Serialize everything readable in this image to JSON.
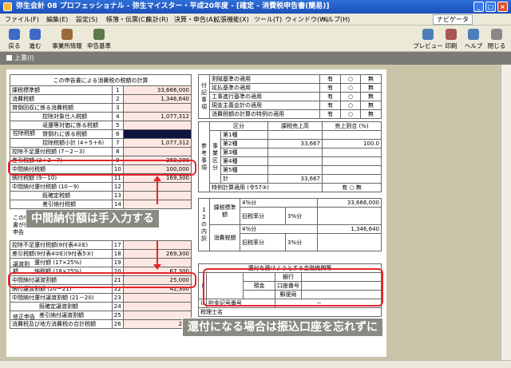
{
  "window": {
    "title": "弥生会計 08 プロフェッショナル - 弥生マイスター・平成20年度 - [確定 - 消費税申告書(簡易)]"
  },
  "menu": [
    "ファイル(F)",
    "編集(E)",
    "設定(S)",
    "帳簿・伝票(C)",
    "集計(R)",
    "決算・申告(A)",
    "拡張機能(X)",
    "ツール(T)",
    "ウィンドウ(W)",
    "ヘルプ(H)"
  ],
  "navi": "ナビゲータ",
  "toolbar": {
    "back": "戻る",
    "forward": "進む",
    "office": "事業所情報",
    "form": "申告基準",
    "preview": "プレビュー",
    "print": "印刷",
    "help": "ヘルプ",
    "close": "閉じる"
  },
  "tab": "上書(I)",
  "left_table": {
    "title": "この申告書による消費税の税額の計算",
    "rows": [
      {
        "label": "課税標準額",
        "num": "1",
        "value": "33,666,000"
      },
      {
        "label": "消費税額",
        "num": "2",
        "value": "1,346,640"
      },
      {
        "label": "貸倒回収に係る消費税額",
        "num": "3",
        "value": ""
      },
      {
        "label": "控除対象仕入税額",
        "num": "4",
        "value": "1,077,312"
      },
      {
        "label": "返還等対価に係る税額",
        "num": "5",
        "value": ""
      },
      {
        "label": "貸倒れに係る税額",
        "num": "6",
        "value": ""
      },
      {
        "label": "控除税額小計 (4＋5＋6)",
        "num": "7",
        "value": "1,077,312"
      },
      {
        "label": "控除不足還付税額 (7－2－3)",
        "num": "8",
        "value": ""
      },
      {
        "label": "差引税額 (2＋3－7)",
        "num": "9",
        "value": "269,300"
      },
      {
        "label": "中間納付税額",
        "num": "10",
        "value": "100,000"
      },
      {
        "label": "納付税額 (9－10)",
        "num": "11",
        "value": "169,300"
      },
      {
        "label": "中間納付還付税額 (10－9)",
        "num": "12",
        "value": ""
      },
      {
        "label": "既確定税額",
        "num": "13",
        "value": ""
      },
      {
        "label": "差引納付税額",
        "num": "14",
        "value": ""
      }
    ],
    "group_deduct": "控除税額",
    "group_amend": "この申告書が修正申告",
    "rows2": [
      {
        "label": "控除不足還付税額(8付表4②E)",
        "num": "17",
        "value": ""
      },
      {
        "label": "差引税額(9付表4②E)(9付表5③)",
        "num": "18",
        "value": "269,300"
      },
      {
        "label": "還付額 (17×25%)",
        "num": "19",
        "value": ""
      },
      {
        "label": "納税額 (18×25%)",
        "num": "20",
        "value": "67,300"
      },
      {
        "label": "中間納付譲渡割額",
        "num": "21",
        "value": "25,000"
      },
      {
        "label": "納付譲渡割額 (20－21)",
        "num": "22",
        "value": "42,300"
      },
      {
        "label": "中間納付還付譲渡割額 (21－20)",
        "num": "23",
        "value": ""
      },
      {
        "label": "既確定譲渡割額",
        "num": "24",
        "value": ""
      },
      {
        "label": "差引納付譲渡割額",
        "num": "25",
        "value": ""
      },
      {
        "label": "消費税及び地方消費税の合計税額",
        "num": "26",
        "value": "211"
      }
    ],
    "group_transfer": "譲渡割額",
    "group_amend2": "修正申告"
  },
  "right_top": {
    "side": "付記事項",
    "rows": [
      {
        "label": "割賦基準の適用",
        "a": "有",
        "b": "○",
        "c": "無"
      },
      {
        "label": "延払基準の適用",
        "a": "有",
        "b": "○",
        "c": "無"
      },
      {
        "label": "工事進行基準の適用",
        "a": "有",
        "b": "○",
        "c": "無"
      },
      {
        "label": "現金主義会計の適用",
        "a": "有",
        "b": "○",
        "c": "無"
      },
      {
        "label": "消費税額の計算の特例の適用",
        "a": "有",
        "b": "○",
        "c": "無"
      }
    ],
    "ref_side": "参考事項",
    "head": [
      "区分",
      "課税売上高",
      "売上割合 (%)"
    ],
    "biz_side": "事業区分",
    "biz": [
      {
        "label": "第1種",
        "v": "",
        "p": ""
      },
      {
        "label": "第2種",
        "v": "33,667",
        "p": "100.0"
      },
      {
        "label": "第3種",
        "v": "",
        "p": ""
      },
      {
        "label": "第4種",
        "v": "",
        "p": ""
      },
      {
        "label": "第5種",
        "v": "",
        "p": ""
      },
      {
        "label": "計",
        "v": "33,667",
        "p": ""
      }
    ],
    "special": "特例計算適用 (令57③)",
    "breakdown_side": "1 2の内訳",
    "tax_base": "課税標準額",
    "consumption": "消費税額",
    "old_rate": "旧税率分",
    "r4": "4%分",
    "r3": "3%分",
    "v_base": "33,666,000",
    "v_cons": "1,346,640"
  },
  "bank": {
    "title": "還付を受けようとする金融機関等",
    "bank": "銀行",
    "deposit": "預金",
    "account": "口座番号",
    "post": "郵便局",
    "postal_no": "貯金記号番号",
    "tax_office": "税理士名"
  },
  "annotations": {
    "a1": "中間納付額は手入力する",
    "a2": "還付になる場合は振込口座を忘れずに"
  }
}
